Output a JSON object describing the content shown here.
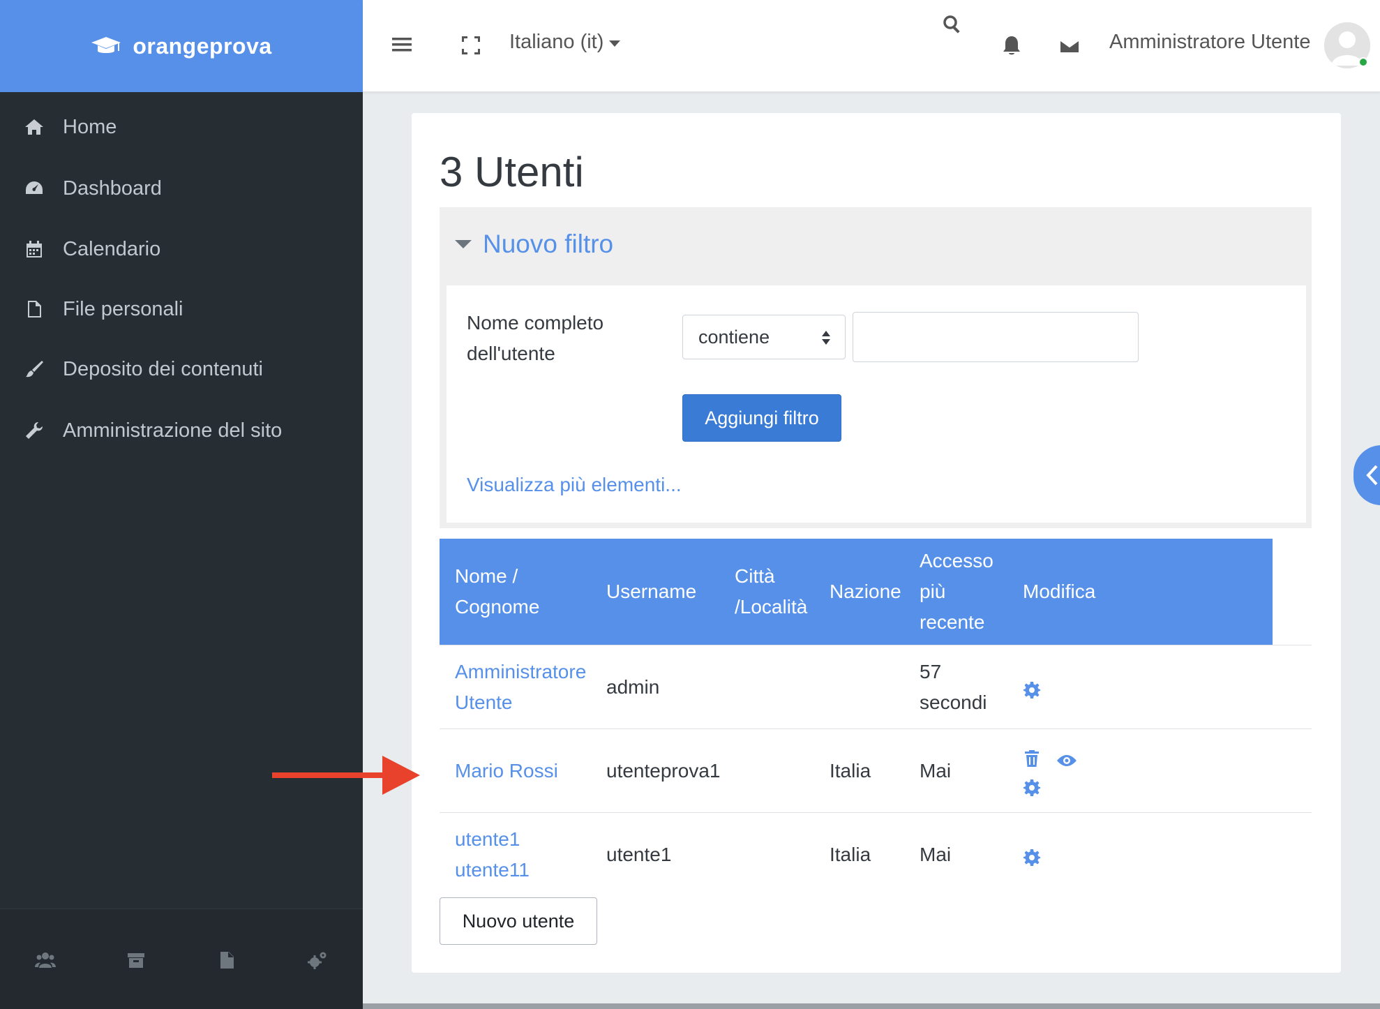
{
  "brand": {
    "name": "orangeprova",
    "icon": "graduation-cap-icon"
  },
  "sidebar": {
    "items": [
      {
        "label": "Home",
        "icon": "home-icon"
      },
      {
        "label": "Dashboard",
        "icon": "dashboard-icon"
      },
      {
        "label": "Calendario",
        "icon": "calendar-icon"
      },
      {
        "label": "File personali",
        "icon": "file-icon"
      },
      {
        "label": "Deposito dei contenuti",
        "icon": "paintbrush-icon"
      },
      {
        "label": "Amministrazione del sito",
        "icon": "wrench-icon"
      }
    ],
    "footer_icons": [
      "users-icon",
      "archive-icon",
      "document-icon",
      "cogs-icon"
    ]
  },
  "topbar": {
    "language": "Italiano (it)",
    "user_name": "Amministratore Utente"
  },
  "page": {
    "title": "3 Utenti"
  },
  "filter": {
    "legend": "Nuovo filtro",
    "field_label": "Nome completo dell'utente",
    "operator": "contiene",
    "value": "",
    "add_button": "Aggiungi filtro",
    "show_more": "Visualizza più elementi..."
  },
  "table": {
    "headers": [
      "Nome / Cognome",
      "Username",
      "Città /Località",
      "Nazione",
      "Accesso più recente",
      "Modifica"
    ],
    "rows": [
      {
        "name": "Amministratore Utente",
        "username": "admin",
        "city": "",
        "country": "",
        "last_access": "57 secondi",
        "actions": [
          "settings"
        ]
      },
      {
        "name": "Mario Rossi",
        "username": "utenteprova1",
        "city": "",
        "country": "Italia",
        "last_access": "Mai",
        "actions": [
          "delete",
          "view",
          "settings"
        ]
      },
      {
        "name": "utente1 utente11",
        "username": "utente1",
        "city": "",
        "country": "Italia",
        "last_access": "Mai",
        "actions": [
          "settings"
        ]
      }
    ]
  },
  "new_user_button": "Nuovo utente",
  "colors": {
    "primary": "#5690e8",
    "sidebar_bg": "#262d33",
    "button_blue": "#3a7bd5",
    "annotation_arrow": "#e8412c"
  }
}
